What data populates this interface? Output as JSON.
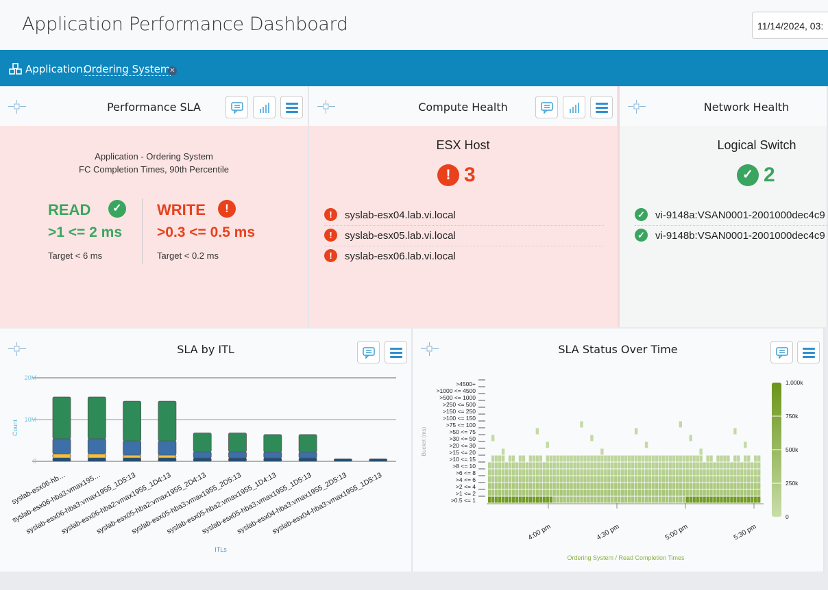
{
  "header": {
    "title": "Application Performance Dashboard",
    "datetime": "11/14/2024, 03:"
  },
  "filter": {
    "label": "Application:",
    "value": "Ordering System",
    "remove_icon": "close-icon"
  },
  "perf_sla": {
    "title": "Performance SLA",
    "line1": "Application - Ordering System",
    "line2": "FC Completion Times, 90th Percentile",
    "read": {
      "label": "READ",
      "value": ">1 <= 2 ms",
      "target": "Target < 6 ms",
      "status": "ok"
    },
    "write": {
      "label": "WRITE",
      "value": ">0.3 <= 0.5 ms",
      "target": "Target < 0.2 ms",
      "status": "error"
    }
  },
  "compute": {
    "title": "Compute Health",
    "heading": "ESX Host",
    "count": "3",
    "items": [
      "syslab-esx04.lab.vi.local",
      "syslab-esx05.lab.vi.local",
      "syslab-esx06.lab.vi.local"
    ]
  },
  "network": {
    "title": "Network Health",
    "heading": "Logical Switch",
    "count": "2",
    "items": [
      "vi-9148a:VSAN0001-2001000dec4c9",
      "vi-9148b:VSAN0001-2001000dec4c9"
    ]
  },
  "colors": {
    "accent": "#0f86bc",
    "error": "#e8411c",
    "ok": "#3aa560",
    "heat": "#6b9418"
  },
  "chart_data": [
    {
      "type": "bar",
      "title": "SLA by ITL",
      "xlabel": "ITLs",
      "ylabel": "Count",
      "ylim": [
        0,
        20000000
      ],
      "yticks": [
        "0",
        "10M",
        "20M"
      ],
      "grid": true,
      "categories": [
        "syslab-esx06-hb…",
        "syslab-esx06-hba3:vmax195…",
        "syslab-esx06-hba3:vmax1955_1D5:13",
        "syslab-esx06-hba2:vmax1955_1D4:13",
        "syslab-esx05-hba2:vmax1955_2D4:13",
        "syslab-esx05-hba3:vmax1955_2D5:13",
        "syslab-esx05-hba2:vmax1955_1D4:13",
        "syslab-esx05-hba3:vmax1955_1D5:13",
        "syslab-esx04-hba3:vmax1955_2D5:13",
        "syslab-esx04-hba3:vmax1955_1D5:13"
      ],
      "series": [
        {
          "color": "#1f4e7a",
          "values": [
            800000,
            800000,
            800000,
            800000,
            800000,
            800000,
            800000,
            800000,
            600000,
            600000
          ]
        },
        {
          "color": "#f0c040",
          "values": [
            1000000,
            1000000,
            700000,
            700000,
            0,
            0,
            0,
            0,
            0,
            0
          ]
        },
        {
          "color": "#3d6fa8",
          "values": [
            3600000,
            3600000,
            3400000,
            3400000,
            1500000,
            1500000,
            1400000,
            1400000,
            0,
            0
          ]
        },
        {
          "color": "#2e8b57",
          "values": [
            10000000,
            10000000,
            9500000,
            9500000,
            4500000,
            4500000,
            4200000,
            4200000,
            0,
            0
          ]
        }
      ]
    },
    {
      "type": "heatmap",
      "title": "SLA Status Over Time",
      "xlabel": "Ordering System / Read Completion Times",
      "ylabel": "Bucket (ms)",
      "xticks": [
        "4:00 pm",
        "4:30 pm",
        "5:00 pm",
        "5:30 pm"
      ],
      "colorbar": {
        "min": 0,
        "max": 1000000,
        "ticks": [
          "0",
          "250k",
          "500k",
          "750k",
          "1,000k"
        ]
      },
      "buckets": [
        ">0.5 <= 1",
        ">1 <= 2",
        ">2 <= 4",
        ">4 <= 6",
        ">6 <= 8",
        ">8 <= 10",
        ">10 <= 15",
        ">15 <= 20",
        ">20 <= 30",
        ">30 <= 50",
        ">50 <= 75",
        ">75 <= 100",
        ">100 <= 150",
        ">150 <= 250",
        ">250 <= 500",
        ">500 <= 1000",
        ">1000 <= 4500",
        ">4500+"
      ],
      "typical_values": [
        700000,
        250000,
        220000,
        180000,
        150000,
        120000,
        80000,
        0,
        0,
        0,
        0,
        0,
        0,
        0,
        0,
        0,
        0,
        0
      ]
    }
  ]
}
